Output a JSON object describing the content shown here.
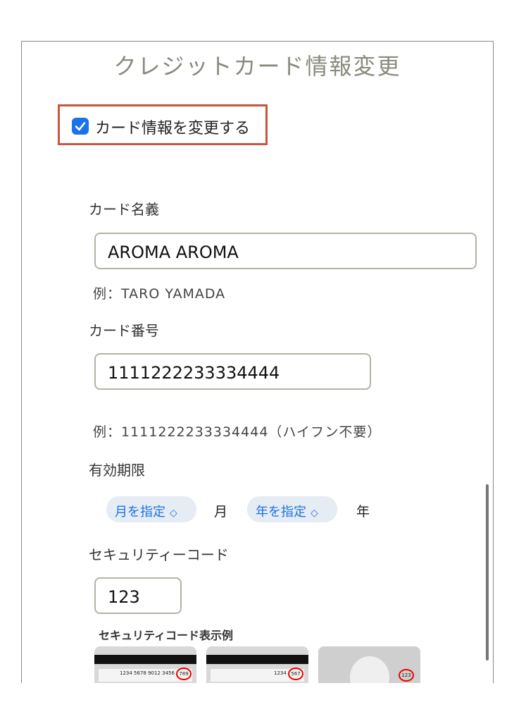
{
  "title": "クレジットカード情報変更",
  "change_checkbox": {
    "label": "カード情報を変更する",
    "checked": true
  },
  "card_name": {
    "label": "カード名義",
    "value": "AROMA AROMA",
    "hint": "例：TARO YAMADA"
  },
  "card_number": {
    "label": "カード番号",
    "value": "1111222233334444",
    "hint": "例：1111222233334444（ハイフン不要）"
  },
  "expiry": {
    "label": "有効期限",
    "month_select": "月を指定",
    "month_unit": "月",
    "year_select": "年を指定",
    "year_unit": "年"
  },
  "security_code": {
    "label": "セキュリティーコード",
    "value": "123",
    "sample_title": "セキュリティコード表示例",
    "samples": [
      {
        "numbers": "1234 5678 9012 3456",
        "code": "789"
      },
      {
        "numbers": "1234",
        "code": "567"
      },
      {
        "code": "123"
      }
    ]
  },
  "colors": {
    "accent": "#1a73e8",
    "highlight_border": "#c8553d"
  }
}
